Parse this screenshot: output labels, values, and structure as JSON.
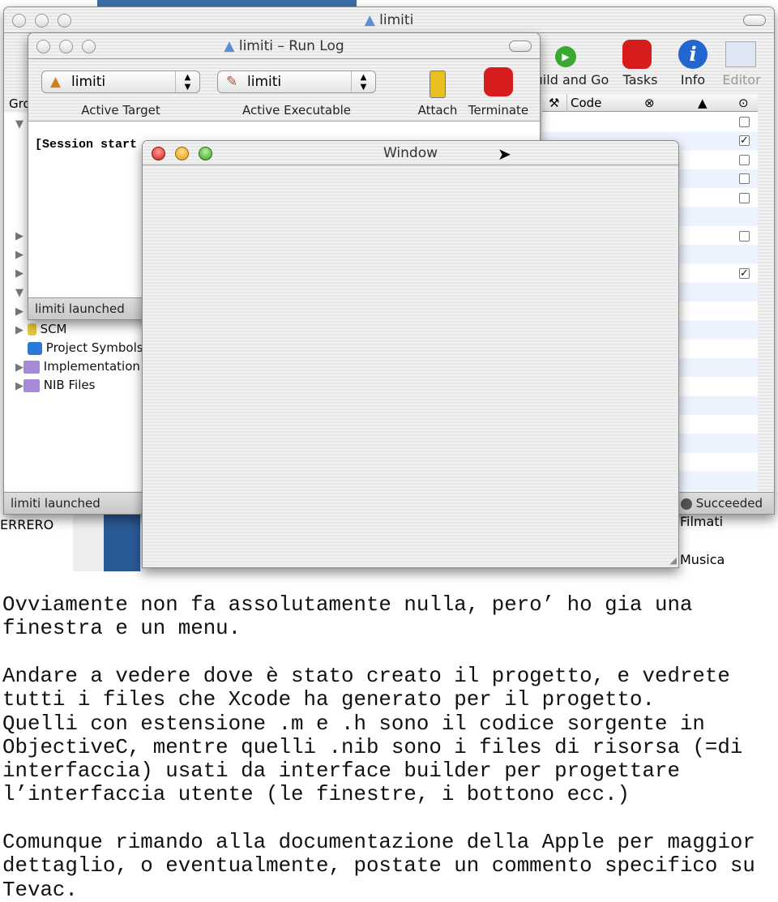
{
  "xcode_window": {
    "title": "limiti",
    "toolbar": [
      {
        "label": "Build and Go",
        "icon": "build-and-go-icon"
      },
      {
        "label": "Tasks",
        "icon": "stop-tasks-icon"
      },
      {
        "label": "Info",
        "icon": "info-icon"
      },
      {
        "label": "Editor",
        "icon": "editor-icon"
      }
    ],
    "groups_header": "Gro",
    "table_columns": [
      {
        "icon": "hammer-icon"
      },
      {
        "label": "Code"
      },
      {
        "icon": "error-icon"
      },
      {
        "icon": "warning-icon"
      },
      {
        "icon": "target-icon"
      }
    ],
    "tree": [
      {
        "label": "SCM",
        "icon": "scm-icon"
      },
      {
        "label": "Project Symbols",
        "icon": "cube-icon"
      },
      {
        "label": "Implementation",
        "icon": "smart-folder-icon"
      },
      {
        "label": "NIB Files",
        "icon": "smart-folder-icon"
      }
    ],
    "checkboxes": [
      false,
      true,
      false,
      false,
      false,
      false,
      true
    ],
    "status_left": "limiti launched",
    "status_right": "Succeeded"
  },
  "run_log": {
    "title": "limiti – Run Log",
    "active_target": {
      "value": "limiti",
      "label": "Active Target"
    },
    "active_executable": {
      "value": "limiti",
      "label": "Active Executable"
    },
    "attach": "Attach",
    "terminate": "Terminate",
    "log_text": "[Session start",
    "status": "limiti launched"
  },
  "app_window": {
    "title": "Window"
  },
  "background": {
    "left_text": "ERRERO",
    "right_items": [
      "Filmati",
      "Musica"
    ]
  },
  "article": {
    "paragraphs": [
      "Ovviamente non fa assolutamente nulla, pero’ ho gia una\nfinestra e un menu.",
      "Andare a vedere dove è stato creato il progetto, e vedrete\ntutti i files che Xcode ha generato per il progetto.\nQuelli con estensione .m e .h sono il codice sorgente in\nObjectiveC, mentre quelli .nib sono i files di risorsa (=di\ninterfaccia) usati da interface builder per progettare\nl’interfaccia utente (le finestre, i bottono ecc.)",
      "Comunque rimando alla documentazione della Apple per maggior\ndettaglio, o eventualmente, postate un commento specifico su\nTevac."
    ]
  }
}
